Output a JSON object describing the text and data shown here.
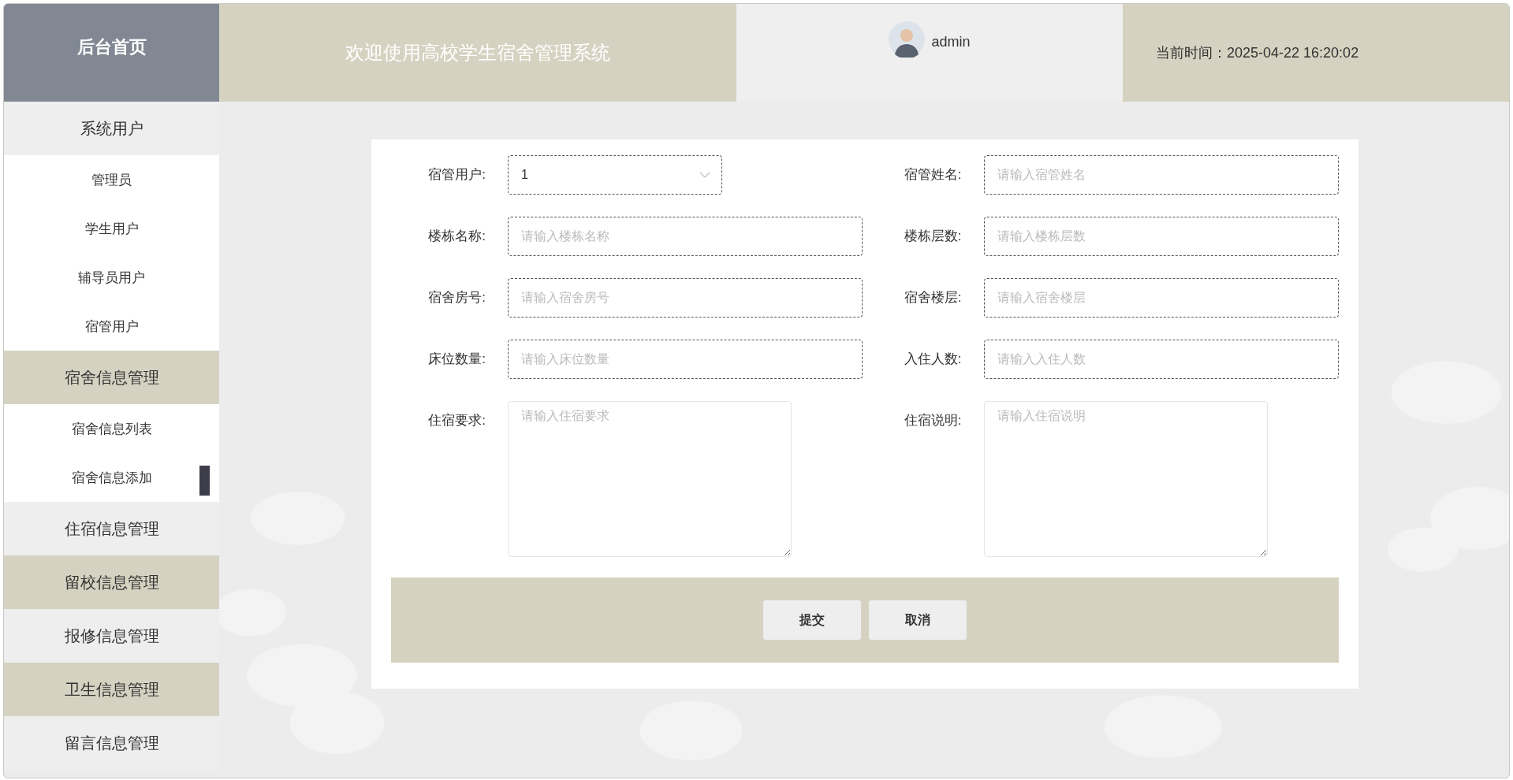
{
  "header": {
    "logo": "后台首页",
    "title": "欢迎使用高校学生宿舍管理系统",
    "user": {
      "name": "admin"
    },
    "clock": "当前时间：2025-04-22 16:20:02"
  },
  "sidebar": {
    "groups": [
      {
        "label": "系统用户",
        "children": [
          {
            "label": "管理员",
            "selected": false
          },
          {
            "label": "学生用户",
            "selected": false
          },
          {
            "label": "辅导员用户",
            "selected": false
          },
          {
            "label": "宿管用户",
            "selected": false
          }
        ]
      },
      {
        "label": "宿舍信息管理",
        "children": [
          {
            "label": "宿舍信息列表",
            "selected": false
          },
          {
            "label": "宿舍信息添加",
            "selected": true
          }
        ]
      },
      {
        "label": "住宿信息管理"
      },
      {
        "label": "留校信息管理"
      },
      {
        "label": "报修信息管理"
      },
      {
        "label": "卫生信息管理"
      },
      {
        "label": "留言信息管理"
      }
    ]
  },
  "form": {
    "fields": [
      {
        "kind": "select",
        "label": "宿管用户:",
        "value": "1"
      },
      {
        "kind": "input",
        "label": "宿管姓名:",
        "placeholder": "请输入宿管姓名"
      },
      {
        "kind": "input",
        "label": "楼栋名称:",
        "placeholder": "请输入楼栋名称"
      },
      {
        "kind": "input",
        "label": "楼栋层数:",
        "placeholder": "请输入楼栋层数"
      },
      {
        "kind": "input",
        "label": "宿舍房号:",
        "placeholder": "请输入宿舍房号"
      },
      {
        "kind": "input",
        "label": "宿舍楼层:",
        "placeholder": "请输入宿舍楼层"
      },
      {
        "kind": "input",
        "label": "床位数量:",
        "placeholder": "请输入床位数量"
      },
      {
        "kind": "input",
        "label": "入住人数:",
        "placeholder": "请输入入住人数"
      },
      {
        "kind": "textarea",
        "label": "住宿要求:",
        "placeholder": "请输入住宿要求"
      },
      {
        "kind": "textarea",
        "label": "住宿说明:",
        "placeholder": "请输入住宿说明"
      }
    ],
    "buttons": [
      "提交",
      "取消"
    ]
  }
}
